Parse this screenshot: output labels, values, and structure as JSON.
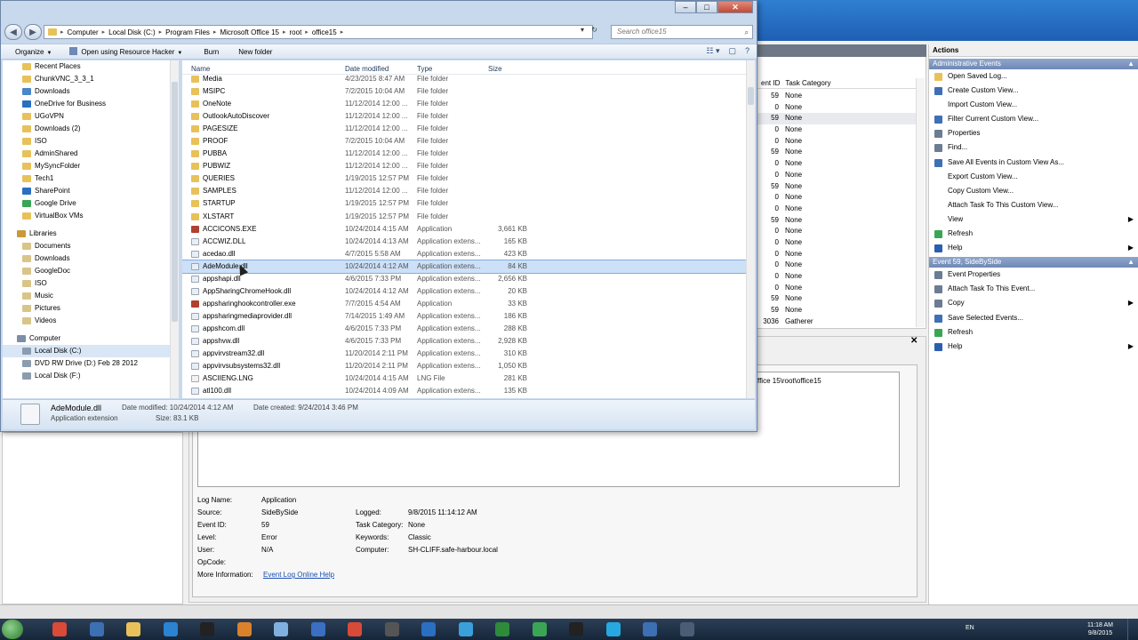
{
  "explorer": {
    "breadcrumb": [
      "Computer",
      "Local Disk (C:)",
      "Program Files",
      "Microsoft Office 15",
      "root",
      "office15"
    ],
    "search_placeholder": "Search office15",
    "toolbar": {
      "organize": "Organize",
      "open_with": "Open using Resource Hacker",
      "burn": "Burn",
      "new_folder": "New folder"
    },
    "nav_items": [
      {
        "label": "Recent Places",
        "level": 2,
        "color": "#e8c15a"
      },
      {
        "label": "ChunkVNC_3_3_1",
        "level": 2,
        "color": "#e8c15a"
      },
      {
        "label": "Downloads",
        "level": 2,
        "color": "#4a86c8"
      },
      {
        "label": "OneDrive for Business",
        "level": 2,
        "color": "#2a6fc2"
      },
      {
        "label": "UGoVPN",
        "level": 2,
        "color": "#e8c15a"
      },
      {
        "label": "Downloads (2)",
        "level": 2,
        "color": "#e8c15a"
      },
      {
        "label": "ISO",
        "level": 2,
        "color": "#e8c15a"
      },
      {
        "label": "AdminShared",
        "level": 2,
        "color": "#e8c15a"
      },
      {
        "label": "MySyncFolder",
        "level": 2,
        "color": "#e8c15a"
      },
      {
        "label": "Tech1",
        "level": 2,
        "color": "#e8c15a"
      },
      {
        "label": "SharePoint",
        "level": 2,
        "color": "#2a6fc2"
      },
      {
        "label": "Google Drive",
        "level": 2,
        "color": "#3aa655"
      },
      {
        "label": "VirtualBox VMs",
        "level": 2,
        "color": "#e8c15a"
      },
      {
        "gap": true
      },
      {
        "label": "Libraries",
        "level": 1,
        "color": "#c99a3a"
      },
      {
        "label": "Documents",
        "level": 2,
        "color": "#d9c48a"
      },
      {
        "label": "Downloads",
        "level": 2,
        "color": "#d9c48a"
      },
      {
        "label": "GoogleDoc",
        "level": 2,
        "color": "#d9c48a"
      },
      {
        "label": "ISO",
        "level": 2,
        "color": "#d9c48a"
      },
      {
        "label": "Music",
        "level": 2,
        "color": "#d9c48a"
      },
      {
        "label": "Pictures",
        "level": 2,
        "color": "#d9c48a"
      },
      {
        "label": "Videos",
        "level": 2,
        "color": "#d9c48a"
      },
      {
        "gap": true
      },
      {
        "label": "Computer",
        "level": 1,
        "color": "#7a8ea8"
      },
      {
        "label": "Local Disk (C:)",
        "level": 2,
        "color": "#8c9cb0",
        "selected": true
      },
      {
        "label": "DVD RW Drive (D:) Feb 28 2012",
        "level": 2,
        "color": "#8c9cb0"
      },
      {
        "label": "Local Disk (F:)",
        "level": 2,
        "color": "#8c9cb0"
      }
    ],
    "columns": {
      "name": "Name",
      "date": "Date modified",
      "type": "Type",
      "size": "Size"
    },
    "files": [
      {
        "name": "Media",
        "date": "4/23/2015 8:47 AM",
        "type": "File folder",
        "size": "",
        "kind": "folder"
      },
      {
        "name": "MSIPC",
        "date": "7/2/2015 10:04 AM",
        "type": "File folder",
        "size": "",
        "kind": "folder"
      },
      {
        "name": "OneNote",
        "date": "11/12/2014 12:00 ...",
        "type": "File folder",
        "size": "",
        "kind": "folder"
      },
      {
        "name": "OutlookAutoDiscover",
        "date": "11/12/2014 12:00 ...",
        "type": "File folder",
        "size": "",
        "kind": "folder"
      },
      {
        "name": "PAGESIZE",
        "date": "11/12/2014 12:00 ...",
        "type": "File folder",
        "size": "",
        "kind": "folder"
      },
      {
        "name": "PROOF",
        "date": "7/2/2015 10:04 AM",
        "type": "File folder",
        "size": "",
        "kind": "folder"
      },
      {
        "name": "PUBBA",
        "date": "11/12/2014 12:00 ...",
        "type": "File folder",
        "size": "",
        "kind": "folder"
      },
      {
        "name": "PUBWIZ",
        "date": "11/12/2014 12:00 ...",
        "type": "File folder",
        "size": "",
        "kind": "folder"
      },
      {
        "name": "QUERIES",
        "date": "1/19/2015 12:57 PM",
        "type": "File folder",
        "size": "",
        "kind": "folder"
      },
      {
        "name": "SAMPLES",
        "date": "11/12/2014 12:00 ...",
        "type": "File folder",
        "size": "",
        "kind": "folder"
      },
      {
        "name": "STARTUP",
        "date": "1/19/2015 12:57 PM",
        "type": "File folder",
        "size": "",
        "kind": "folder"
      },
      {
        "name": "XLSTART",
        "date": "1/19/2015 12:57 PM",
        "type": "File folder",
        "size": "",
        "kind": "folder"
      },
      {
        "name": "ACCICONS.EXE",
        "date": "10/24/2014 4:15 AM",
        "type": "Application",
        "size": "3,661 KB",
        "kind": "app"
      },
      {
        "name": "ACCWIZ.DLL",
        "date": "10/24/2014 4:13 AM",
        "type": "Application extens...",
        "size": "165 KB",
        "kind": "dll"
      },
      {
        "name": "acedao.dll",
        "date": "4/7/2015 5:58 AM",
        "type": "Application extens...",
        "size": "423 KB",
        "kind": "dll"
      },
      {
        "name": "AdeModule.dll",
        "date": "10/24/2014 4:12 AM",
        "type": "Application extens...",
        "size": "84 KB",
        "kind": "dll",
        "selected": true
      },
      {
        "name": "appshapi.dll",
        "date": "4/6/2015 7:33 PM",
        "type": "Application extens...",
        "size": "2,656 KB",
        "kind": "dll"
      },
      {
        "name": "AppSharingChromeHook.dll",
        "date": "10/24/2014 4:12 AM",
        "type": "Application extens...",
        "size": "20 KB",
        "kind": "dll"
      },
      {
        "name": "appsharinghookcontroller.exe",
        "date": "7/7/2015 4:54 AM",
        "type": "Application",
        "size": "33 KB",
        "kind": "app"
      },
      {
        "name": "appsharingmediaprovider.dll",
        "date": "7/14/2015 1:49 AM",
        "type": "Application extens...",
        "size": "186 KB",
        "kind": "dll"
      },
      {
        "name": "appshcom.dll",
        "date": "4/6/2015 7:33 PM",
        "type": "Application extens...",
        "size": "288 KB",
        "kind": "dll"
      },
      {
        "name": "appshvw.dll",
        "date": "4/6/2015 7:33 PM",
        "type": "Application extens...",
        "size": "2,928 KB",
        "kind": "dll"
      },
      {
        "name": "appvirvstream32.dll",
        "date": "11/20/2014 2:11 PM",
        "type": "Application extens...",
        "size": "310 KB",
        "kind": "dll"
      },
      {
        "name": "appvirvsubsystems32.dll",
        "date": "11/20/2014 2:11 PM",
        "type": "Application extens...",
        "size": "1,050 KB",
        "kind": "dll"
      },
      {
        "name": "ASCIIENG.LNG",
        "date": "10/24/2014 4:15 AM",
        "type": "LNG File",
        "size": "281 KB",
        "kind": "lng"
      },
      {
        "name": "atl100.dll",
        "date": "10/24/2014 4:09 AM",
        "type": "Application extens...",
        "size": "135 KB",
        "kind": "dll"
      }
    ],
    "details": {
      "name": "AdeModule.dll",
      "type": "Application extension",
      "modified": "Date modified: 10/24/2014 4:12 AM",
      "size": "Size: 83.1 KB",
      "created": "Date created: 9/24/2014 3:46 PM"
    }
  },
  "event_viewer": {
    "grid_columns": {
      "id": "ent ID",
      "category": "Task Category"
    },
    "rows": [
      {
        "id": "59",
        "cat": "None"
      },
      {
        "id": "0",
        "cat": "None"
      },
      {
        "id": "59",
        "cat": "None",
        "alt": true
      },
      {
        "id": "0",
        "cat": "None"
      },
      {
        "id": "0",
        "cat": "None"
      },
      {
        "id": "59",
        "cat": "None"
      },
      {
        "id": "0",
        "cat": "None"
      },
      {
        "id": "0",
        "cat": "None"
      },
      {
        "id": "59",
        "cat": "None"
      },
      {
        "id": "0",
        "cat": "None"
      },
      {
        "id": "0",
        "cat": "None"
      },
      {
        "id": "59",
        "cat": "None"
      },
      {
        "id": "0",
        "cat": "None"
      },
      {
        "id": "0",
        "cat": "None"
      },
      {
        "id": "0",
        "cat": "None"
      },
      {
        "id": "0",
        "cat": "None"
      },
      {
        "id": "0",
        "cat": "None"
      },
      {
        "id": "0",
        "cat": "None"
      },
      {
        "id": "59",
        "cat": "None"
      },
      {
        "id": "59",
        "cat": "None"
      },
      {
        "id": "3036",
        "cat": "Gatherer"
      }
    ],
    "message_path": "ffice 15\\root\\office15",
    "fields": {
      "log_name_k": "Log Name:",
      "log_name_v": "Application",
      "source_k": "Source:",
      "source_v": "SideBySide",
      "logged_k": "Logged:",
      "logged_v": "9/8/2015 11:14:12 AM",
      "event_id_k": "Event ID:",
      "event_id_v": "59",
      "task_cat_k": "Task Category:",
      "task_cat_v": "None",
      "level_k": "Level:",
      "level_v": "Error",
      "keywords_k": "Keywords:",
      "keywords_v": "Classic",
      "user_k": "User:",
      "user_v": "N/A",
      "computer_k": "Computer:",
      "computer_v": "SH-CLIFF.safe-harbour.local",
      "opcode_k": "OpCode:",
      "more_info_k": "More Information:",
      "more_info_link": "Event Log Online Help"
    },
    "actions": {
      "title": "Actions",
      "section1": "Administrative Events",
      "items1": [
        {
          "label": "Open Saved Log...",
          "color": "#e8c15a"
        },
        {
          "label": "Create Custom View...",
          "color": "#3f6fb5"
        },
        {
          "label": "Import Custom View...",
          "color": ""
        },
        {
          "label": "Filter Current Custom View...",
          "color": "#3f6fb5"
        },
        {
          "label": "Properties",
          "color": "#6b7c93"
        },
        {
          "label": "Find...",
          "color": "#6b7c93"
        },
        {
          "label": "Save All Events in Custom View As...",
          "color": "#3f6fb5"
        },
        {
          "label": "Export Custom View...",
          "color": ""
        },
        {
          "label": "Copy Custom View...",
          "color": ""
        },
        {
          "label": "Attach Task To This Custom View...",
          "color": ""
        },
        {
          "label": "View",
          "color": "",
          "submenu": true
        },
        {
          "label": "Refresh",
          "color": "#3aa655"
        },
        {
          "label": "Help",
          "color": "#2a5fb0",
          "submenu": true
        }
      ],
      "section2": "Event 59, SideBySide",
      "items2": [
        {
          "label": "Event Properties",
          "color": "#6b7c93"
        },
        {
          "label": "Attach Task To This Event...",
          "color": "#6b7c93"
        },
        {
          "label": "Copy",
          "color": "#6b7c93",
          "submenu": true
        },
        {
          "label": "Save Selected Events...",
          "color": "#3f6fb5"
        },
        {
          "label": "Refresh",
          "color": "#3aa655"
        },
        {
          "label": "Help",
          "color": "#2a5fb0",
          "submenu": true
        }
      ]
    }
  },
  "taskbar": {
    "apps": [
      {
        "name": "chrome",
        "color": "#d94a38"
      },
      {
        "name": "network",
        "color": "#3d6fb3"
      },
      {
        "name": "explorer",
        "color": "#e8c15a"
      },
      {
        "name": "ie",
        "color": "#2a84d2"
      },
      {
        "name": "terminal",
        "color": "#222"
      },
      {
        "name": "firefox",
        "color": "#d9822b"
      },
      {
        "name": "remote",
        "color": "#7fb0e0"
      },
      {
        "name": "tool",
        "color": "#3a6fc2"
      },
      {
        "name": "circle",
        "color": "#d94a38"
      },
      {
        "name": "delta",
        "color": "#555"
      },
      {
        "name": "outlook",
        "color": "#2a6fc2"
      },
      {
        "name": "vm",
        "color": "#3aa0d9"
      },
      {
        "name": "excel",
        "color": "#2e8b3a"
      },
      {
        "name": "logo-green",
        "color": "#3aa655"
      },
      {
        "name": "shield",
        "color": "#222"
      },
      {
        "name": "skype",
        "color": "#28a8e0"
      },
      {
        "name": "screens",
        "color": "#3d6fb3"
      },
      {
        "name": "window",
        "color": "#4a5d74"
      }
    ],
    "lang": "EN",
    "time": "11:18 AM",
    "date": "9/8/2015"
  }
}
